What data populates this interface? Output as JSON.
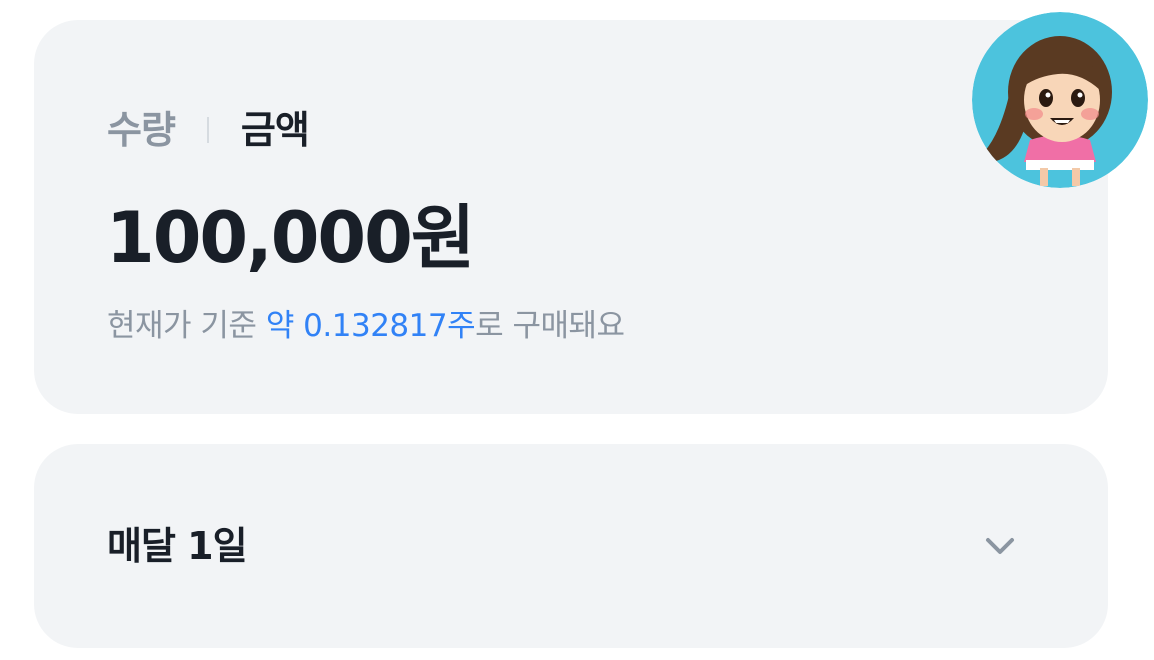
{
  "tabs": {
    "quantity_label": "수량",
    "amount_label": "금액",
    "active": "amount"
  },
  "amount": {
    "value": "100,000원"
  },
  "description": {
    "prefix": "현재가 기준 ",
    "highlight": "약 0.132817주",
    "suffix": "로 구매돼요"
  },
  "schedule": {
    "label": "매달 1일",
    "icon": "chevron-down-icon"
  },
  "avatar": {
    "icon": "avatar-cartoon-girl"
  },
  "colors": {
    "card_bg": "#f2f4f6",
    "text_primary": "#191f28",
    "text_secondary": "#8b95a1",
    "accent": "#3182f6",
    "avatar_bg": "#4cc3dd"
  }
}
